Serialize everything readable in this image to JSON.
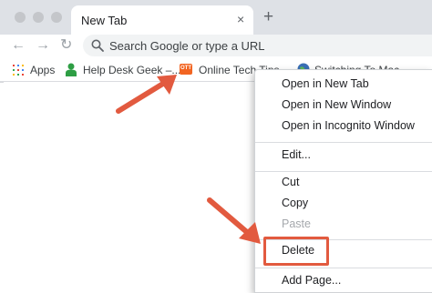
{
  "tab": {
    "title": "New Tab",
    "close_glyph": "×"
  },
  "new_tab_glyph": "+",
  "nav": {
    "back": "←",
    "forward": "→",
    "reload": "↻"
  },
  "omnibox": {
    "placeholder": "Search Google or type a URL"
  },
  "bookmarks": [
    {
      "label": "Apps",
      "icon": "apps-grid-icon"
    },
    {
      "label": "Help Desk Geek –...",
      "icon": "person-icon"
    },
    {
      "label": "Online Tech Tips",
      "icon": "ott-logo-icon",
      "icon_text": "OTT"
    },
    {
      "label": "Switching To Mac...",
      "icon": "globe-icon"
    }
  ],
  "context_menu": {
    "items": [
      {
        "label": "Open in New Tab",
        "disabled": false
      },
      {
        "label": "Open in New Window",
        "disabled": false
      },
      {
        "label": "Open in Incognito Window",
        "disabled": false
      },
      {
        "label": "Edit...",
        "disabled": false
      },
      {
        "label": "Cut",
        "disabled": false
      },
      {
        "label": "Copy",
        "disabled": false
      },
      {
        "label": "Paste",
        "disabled": true
      },
      {
        "label": "Delete",
        "disabled": false
      },
      {
        "label": "Add Page...",
        "disabled": false
      }
    ]
  },
  "colors": {
    "annotation": "#e25a3f",
    "titlebar": "#dee1e6",
    "omnibox": "#f1f3f4"
  }
}
